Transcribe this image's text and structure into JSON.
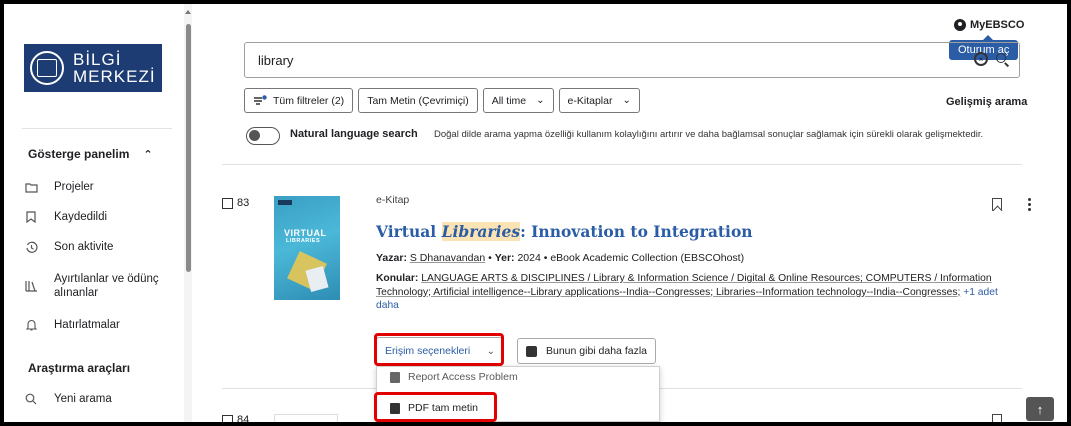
{
  "sidebar": {
    "logo": {
      "line1": "BİLGİ",
      "line2": "MERKEZİ"
    },
    "dashboard": {
      "label": "Gösterge panelim",
      "chevron": "^"
    },
    "items": [
      {
        "label": "Projeler",
        "icon": "folder-icon"
      },
      {
        "label": "Kaydedildi",
        "icon": "bookmark-icon"
      },
      {
        "label": "Son aktivite",
        "icon": "history-icon"
      },
      {
        "label_line1": "Ayırtılanlar ve ödünç",
        "label_line2": "alınanlar",
        "icon": "books-icon"
      },
      {
        "label": "Hatırlatmalar",
        "icon": "bell-icon"
      }
    ],
    "tools": {
      "label": "Araştırma araçları"
    },
    "tool_items": [
      {
        "label": "Yeni arama",
        "icon": "search-icon"
      }
    ]
  },
  "header": {
    "myebsco": "MyEBSCO",
    "tooltip": "Oturum aç"
  },
  "search": {
    "value": "library"
  },
  "filters": {
    "all_filters": "Tüm filtreler (2)",
    "full_text": "Tam Metin (Çevrimiçi)",
    "time": "All time",
    "type": "e-Kitaplar",
    "advanced": "Gelişmiş arama"
  },
  "natural_language": {
    "label": "Natural language search",
    "description": "Doğal dilde arama yapma özelliği kullanım kolaylığını artırır ve daha bağlamsal sonuçlar sağlamak için sürekli olarak gelişmektedir."
  },
  "result": {
    "number": "83",
    "type": "e-Kitap",
    "cover": {
      "line1": "VIRTUAL",
      "line2": "LIBRARIES"
    },
    "title_highlight": "Libraries",
    "title_prefix": "Virtual ",
    "title_suffix": ": Innovation to Integration",
    "author_label": "Yazar:",
    "author": "S Dhanavandan",
    "year_label": "Yer:",
    "year": "2024",
    "collection": "eBook Academic Collection (EBSCOhost)",
    "subjects_label": "Konular:",
    "subjects_text": "LANGUAGE ARTS & DISCIPLINES / Library & Information Science / Digital & Online Resources; COMPUTERS / Information Technology; Artificial intelligence--Library applications--India--Congresses; Libraries--Information technology--India--Congresses;",
    "more": "+1 adet daha",
    "access_button": "Erişim seçenekleri",
    "similar_button": "Bunun gibi daha fazla",
    "dropdown": {
      "report": "Report Access Problem",
      "pdf": "PDF tam metin"
    }
  },
  "next_result": {
    "number": "84"
  }
}
